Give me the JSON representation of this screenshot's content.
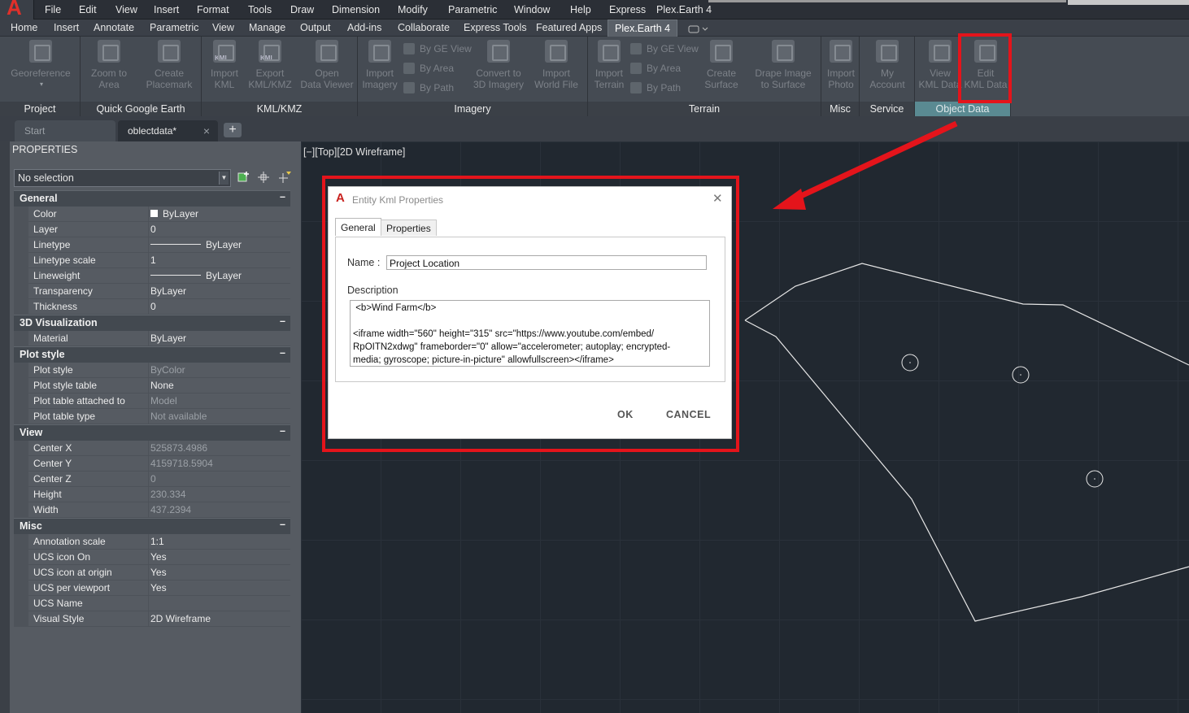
{
  "menu": {
    "items": [
      "File",
      "Edit",
      "View",
      "Insert",
      "Format",
      "Tools",
      "Draw",
      "Dimension",
      "Modify",
      "Parametric",
      "Window",
      "Help",
      "Express",
      "Plex.Earth 4"
    ]
  },
  "ribbon_tabs": [
    "Home",
    "Insert",
    "Annotate",
    "Parametric",
    "View",
    "Manage",
    "Output",
    "Add-ins",
    "Collaborate",
    "Express Tools",
    "Featured Apps",
    "Plex.Earth 4"
  ],
  "ribbon": {
    "panels": {
      "project": "Project",
      "quick_google_earth": "Quick Google Earth",
      "kml": "KML/KMZ",
      "imagery": "Imagery",
      "terrain": "Terrain",
      "misc": "Misc",
      "service": "Service",
      "object_data": "Object Data"
    },
    "buttons": {
      "georeference": "Georeference",
      "zoom_to_area": [
        "Zoom to",
        "Area"
      ],
      "create_placemark": [
        "Create",
        "Placemark"
      ],
      "import_kml": [
        "Import",
        "KML"
      ],
      "export_kml": [
        "Export",
        "KML/KMZ"
      ],
      "open_data_viewer": [
        "Open",
        "Data Viewer"
      ],
      "import_imagery": [
        "Import",
        "Imagery"
      ],
      "img_by_ge_view": "By GE View",
      "img_by_area": "By Area",
      "img_by_path": "By Path",
      "convert_3d": [
        "Convert to",
        "3D Imagery"
      ],
      "import_world_file": [
        "Import",
        "World File"
      ],
      "import_terrain": [
        "Import",
        "Terrain"
      ],
      "ter_by_ge_view": "By GE View",
      "ter_by_area": "By Area",
      "ter_by_path": "By Path",
      "create_surface": [
        "Create",
        "Surface"
      ],
      "drape_image": [
        "Drape Image",
        "to Surface"
      ],
      "import_photo": [
        "Import",
        "Photo"
      ],
      "my_account": [
        "My",
        "Account"
      ],
      "view_kml": [
        "View",
        "KML Data"
      ],
      "edit_kml": [
        "Edit",
        "KML Data"
      ]
    }
  },
  "doc_tabs": {
    "start": "Start",
    "active": "oblectdata*",
    "plus": "+"
  },
  "properties": {
    "title": "PROPERTIES",
    "selection": "No selection",
    "categories": [
      {
        "name": "General",
        "rows": [
          {
            "k": "Color",
            "v": "ByLayer",
            "kind": "swatch"
          },
          {
            "k": "Layer",
            "v": "0"
          },
          {
            "k": "Linetype",
            "v": "ByLayer",
            "kind": "line"
          },
          {
            "k": "Linetype scale",
            "v": "1"
          },
          {
            "k": "Lineweight",
            "v": "ByLayer",
            "kind": "line"
          },
          {
            "k": "Transparency",
            "v": "ByLayer"
          },
          {
            "k": "Thickness",
            "v": "0"
          }
        ]
      },
      {
        "name": "3D Visualization",
        "rows": [
          {
            "k": "Material",
            "v": "ByLayer"
          }
        ]
      },
      {
        "name": "Plot style",
        "rows": [
          {
            "k": "Plot style",
            "v": "ByColor",
            "dim": true
          },
          {
            "k": "Plot style table",
            "v": "None"
          },
          {
            "k": "Plot table attached to",
            "v": "Model",
            "dim": true
          },
          {
            "k": "Plot table type",
            "v": "Not available",
            "dim": true
          }
        ]
      },
      {
        "name": "View",
        "rows": [
          {
            "k": "Center X",
            "v": "525873.4986",
            "dim": true
          },
          {
            "k": "Center Y",
            "v": "4159718.5904",
            "dim": true
          },
          {
            "k": "Center Z",
            "v": "0",
            "dim": true
          },
          {
            "k": "Height",
            "v": "230.334",
            "dim": true
          },
          {
            "k": "Width",
            "v": "437.2394",
            "dim": true
          }
        ]
      },
      {
        "name": "Misc",
        "rows": [
          {
            "k": "Annotation scale",
            "v": "1:1"
          },
          {
            "k": "UCS icon On",
            "v": "Yes"
          },
          {
            "k": "UCS icon at origin",
            "v": "Yes"
          },
          {
            "k": "UCS per viewport",
            "v": "Yes"
          },
          {
            "k": "UCS Name",
            "v": ""
          },
          {
            "k": "Visual Style",
            "v": "2D Wireframe"
          }
        ]
      }
    ]
  },
  "viewport": {
    "label": "[−][Top][2D Wireframe]"
  },
  "dialog": {
    "title": "Entity Kml Properties",
    "tabs": {
      "general": "General",
      "properties": "Properties"
    },
    "name_label": "Name :",
    "name_value": "Project Location",
    "description_label": "Description",
    "description_value": " <b>Wind Farm</b>\n\n<iframe width=\"560\" height=\"315\" src=\"https://www.youtube.com/embed/\nRpOITN2xdwg\" frameborder=\"0\" allow=\"accelerometer; autoplay; encrypted-\nmedia; gyroscope; picture-in-picture\" allowfullscreen></iframe>",
    "ok": "OK",
    "cancel": "CANCEL"
  },
  "colors": {
    "annotation_red": "#e4141b",
    "object_data_panel": "#5a8a92",
    "autocad_red": "#c9211e"
  }
}
